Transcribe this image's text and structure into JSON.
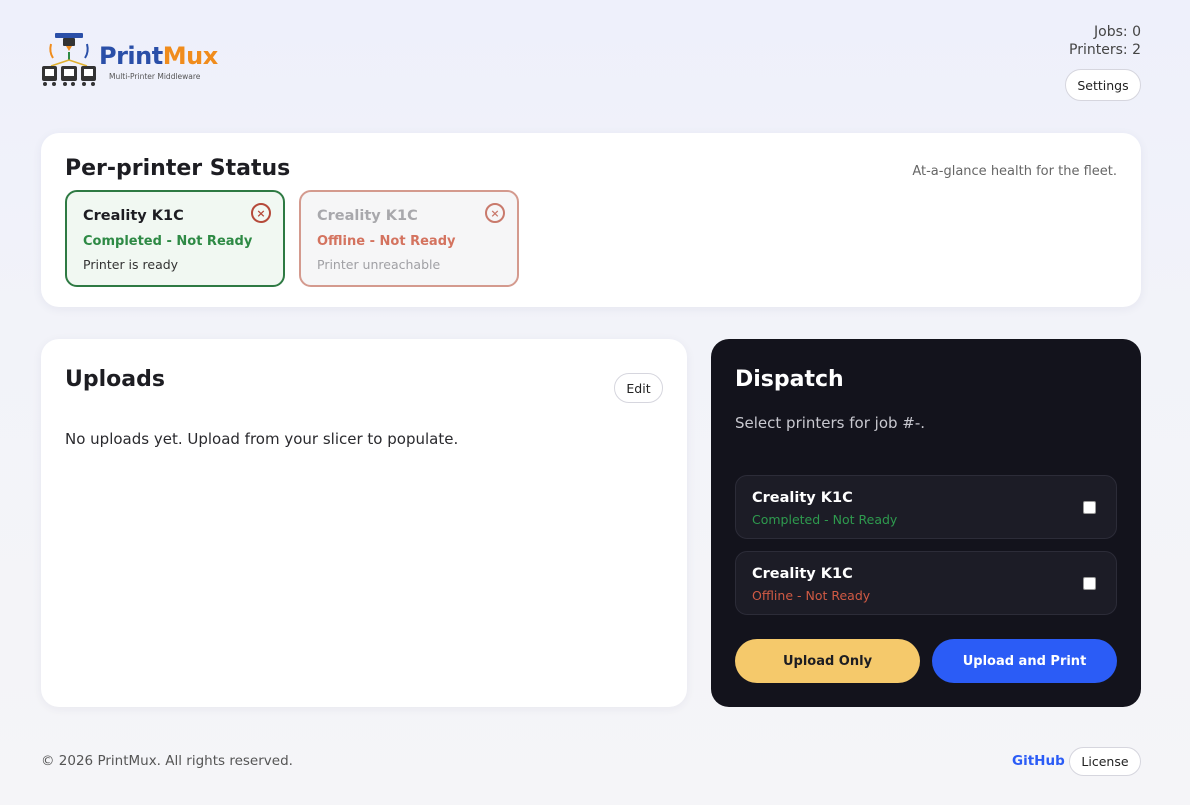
{
  "header": {
    "logo_text_part1": "Print",
    "logo_text_part2": "Mux",
    "logo_subtitle": "Multi-Printer Middleware",
    "jobs_label": "Jobs: 0",
    "printers_label": "Printers: 2",
    "settings_label": "Settings"
  },
  "status": {
    "title": "Per-printer Status",
    "subtitle": "At-a-glance health for the fleet.",
    "printers": [
      {
        "name": "Creality K1C",
        "state": "Completed - Not Ready",
        "note": "Printer is ready"
      },
      {
        "name": "Creality K1C",
        "state": "Offline - Not Ready",
        "note": "Printer unreachable"
      }
    ],
    "close_glyph": "×"
  },
  "uploads": {
    "title": "Uploads",
    "edit_label": "Edit",
    "empty_text": "No uploads yet. Upload from your slicer to populate."
  },
  "dispatch": {
    "title": "Dispatch",
    "subtitle": "Select printers for job #-.",
    "printers": [
      {
        "name": "Creality K1C",
        "state": "Completed - Not Ready"
      },
      {
        "name": "Creality K1C",
        "state": "Offline - Not Ready"
      }
    ],
    "upload_only_label": "Upload Only",
    "upload_print_label": "Upload and Print"
  },
  "footer": {
    "copyright": "© 2026 PrintMux. All rights reserved.",
    "github_label": "GitHub",
    "license_label": "License"
  },
  "colors": {
    "accent_blue": "#2b5cf6",
    "accent_yellow": "#f5c96b",
    "status_green": "#2e8a45",
    "status_red": "#d4735f",
    "dark_panel": "#13131c"
  }
}
